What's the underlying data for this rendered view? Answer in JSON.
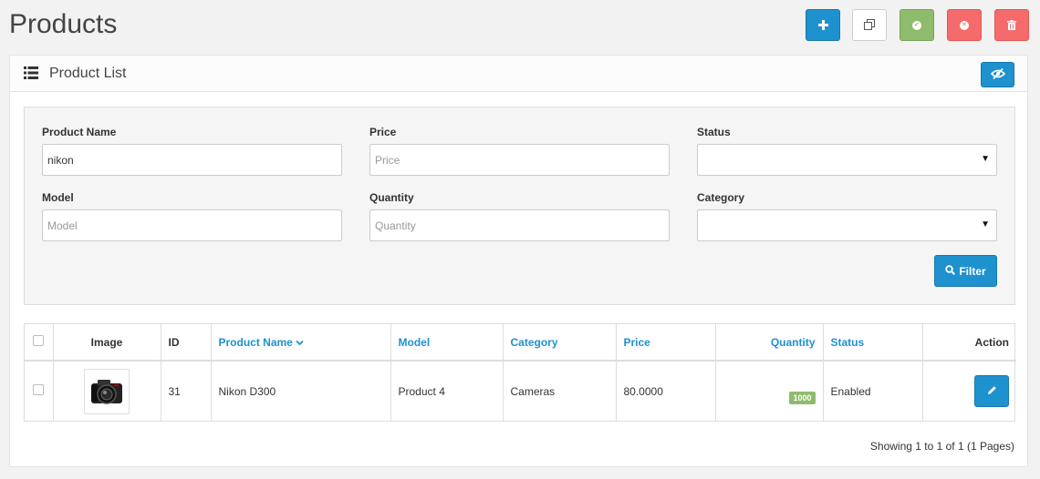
{
  "page": {
    "title": "Products"
  },
  "toolbar": {
    "add_icon": "plus-icon",
    "copy_icon": "copy-icon",
    "enable_icon": "check-circle-icon",
    "disable_icon": "times-circle-icon",
    "delete_icon": "trash-icon"
  },
  "panel": {
    "title": "Product List",
    "toggle_icon": "eye-slash-icon"
  },
  "filter": {
    "product_name_label": "Product Name",
    "product_name_value": "nikon",
    "product_name_placeholder": "Product Name",
    "price_label": "Price",
    "price_placeholder": "Price",
    "status_label": "Status",
    "status_value": "",
    "model_label": "Model",
    "model_placeholder": "Model",
    "quantity_label": "Quantity",
    "quantity_placeholder": "Quantity",
    "category_label": "Category",
    "category_value": "",
    "filter_button": "Filter"
  },
  "table": {
    "headers": {
      "image": "Image",
      "id": "ID",
      "product_name": "Product Name",
      "model": "Model",
      "category": "Category",
      "price": "Price",
      "quantity": "Quantity",
      "status": "Status",
      "action": "Action"
    },
    "rows": [
      {
        "id": "31",
        "product_name": "Nikon D300",
        "model": "Product 4",
        "category": "Cameras",
        "price": "80.0000",
        "quantity": "1000",
        "status": "Enabled"
      }
    ]
  },
  "pagination": {
    "summary": "Showing 1 to 1 of 1 (1 Pages)"
  },
  "colors": {
    "primary": "#1e91cf",
    "success": "#8fbb6c",
    "danger": "#f56b6b"
  }
}
